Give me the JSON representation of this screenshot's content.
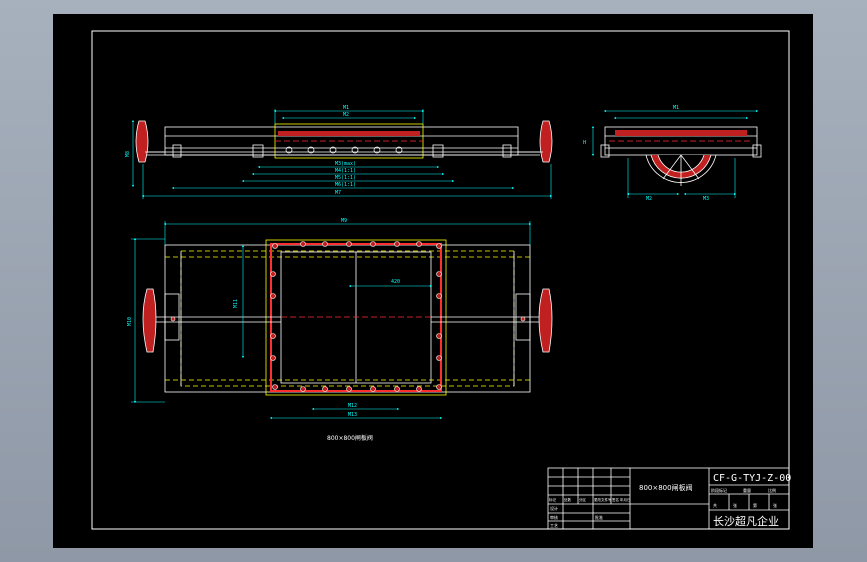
{
  "colors": {
    "paper": "#000000",
    "frame": "#ffffff",
    "outline": "#ffffff",
    "dimension": "#00ffff",
    "center": "#ff3030",
    "hidden": "#ffff00",
    "fill": "#c02020"
  },
  "views": {
    "front_caption": "800×800闸板阀",
    "dims": {
      "d_top_1": "M1",
      "d_top_2": "M2",
      "d_mid": "M3(max)",
      "d_b1": "M4(1:1)",
      "d_b2": "M5(1:1)",
      "d_b3": "M6(1:1)",
      "d_overall": "M7",
      "d_height": "M8",
      "d_side_w": "M1",
      "d_side_h": "H",
      "d_side_b1": "M2",
      "d_side_b2": "M3",
      "d_plan_w": "M9",
      "d_plan_h": "M10",
      "d_plan_in": "M11",
      "d_plan_bot1": "M12",
      "d_plan_bot2": "M13",
      "d_plan_left": "M14",
      "d_plan_c": "420"
    }
  },
  "title_block": {
    "name": "800×800闸板阀",
    "drawing_no": "CF-G-TYJ-Z-00",
    "company": "长沙超凡企业",
    "small_labels": [
      "标记",
      "处数",
      "分区",
      "更改文件号",
      "签名",
      "年月日"
    ],
    "row_labels": [
      "设计",
      "审核",
      "工艺",
      "批准"
    ],
    "stage_labels": [
      "阶段标记",
      "重量",
      "比例"
    ],
    "sheet_labels": [
      "共",
      "张",
      "第",
      "张"
    ]
  }
}
